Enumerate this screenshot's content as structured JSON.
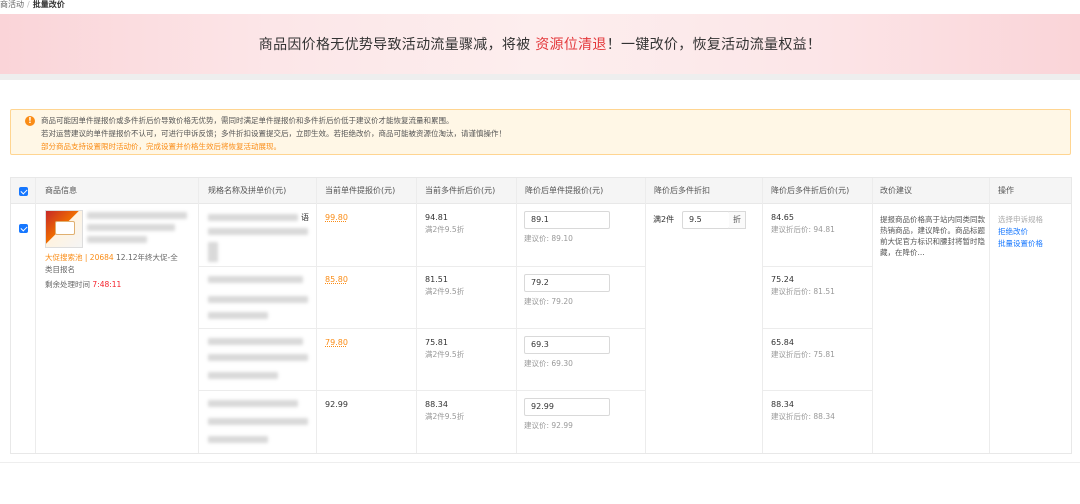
{
  "breadcrumb": {
    "parent": "商活动",
    "sep": "/",
    "current": "批量改价"
  },
  "banner": {
    "prefix": "商品因价格无优势导致活动流量骤减，将被 ",
    "highlight": "资源位清退",
    "suffix": "！一键改价，恢复活动流量权益！"
  },
  "notice": {
    "lines": [
      "商品可能因单件提报价或多件折后价导致价格无优势，需同时满足单件提报价和多件折后价低于建议价才能恢复流量和累围。",
      "若对运营建议的单件提报价不认可，可进行申诉反馈；多件折扣设置提交后，立即生效。若拒绝改价，商品可能被资源位淘汰，请谨慎操作！"
    ],
    "orange_line": "部分商品支持设置限时活动价，完成设置并价格生效后将恢复活动展现。",
    "icon": "warning-icon",
    "icon_glyph": "!"
  },
  "table": {
    "headers": [
      "商品信息",
      "规格名称及拼单价(元)",
      "当前单件提报价(元)",
      "当前多件折后价(元)",
      "降价后单件提报价(元)",
      "降价后多件折扣",
      "降价后多件折后价(元)",
      "改价建议",
      "操作"
    ],
    "product": {
      "tag_label": "大促搜索池",
      "tag_sep": " | ",
      "tag_count": "20684",
      "tag_event": " 12.12年终大促-全",
      "tag_event2": "类目报名",
      "countdown_label": "剩余处理时间 ",
      "countdown_value": "7:48:11"
    },
    "spec_suffix": "语",
    "discount": {
      "label": "满2件",
      "value": "9.5",
      "unit": "折"
    },
    "rows": [
      {
        "current_single": "99.80",
        "current_multi": "94.81",
        "multi_rule": "满2件9.5折",
        "new_single": "89.1",
        "suggest_single": "建议价: 89.10",
        "new_multi": "84.65",
        "suggest_multi": "建议折后价: 94.81"
      },
      {
        "current_single": "85.80",
        "current_multi": "81.51",
        "multi_rule": "满2件9.5折",
        "new_single": "79.2",
        "suggest_single": "建议价: 79.20",
        "new_multi": "75.24",
        "suggest_multi": "建议折后价: 81.51"
      },
      {
        "current_single": "79.80",
        "current_multi": "75.81",
        "multi_rule": "满2件9.5折",
        "new_single": "69.3",
        "suggest_single": "建议价: 69.30",
        "new_multi": "65.84",
        "suggest_multi": "建议折后价: 75.81"
      },
      {
        "current_single": "92.99",
        "current_multi": "88.34",
        "multi_rule": "满2件9.5折",
        "new_single": "92.99",
        "suggest_single": "建议价: 92.99",
        "new_multi": "88.34",
        "suggest_multi": "建议折后价: 88.34"
      }
    ],
    "advice": "提报商品价格高于站内同类同款热销商品，建议降价。商品标题前大促官方标识和腰封将暂时隐藏，在降价...",
    "actions": {
      "appeal": "选择申诉规格",
      "reject": "拒绝改价",
      "batch": "批量设置价格"
    }
  },
  "colors": {
    "accent": "#1677ff",
    "warning": "#fa8c16",
    "highlight": "#e4393c"
  }
}
